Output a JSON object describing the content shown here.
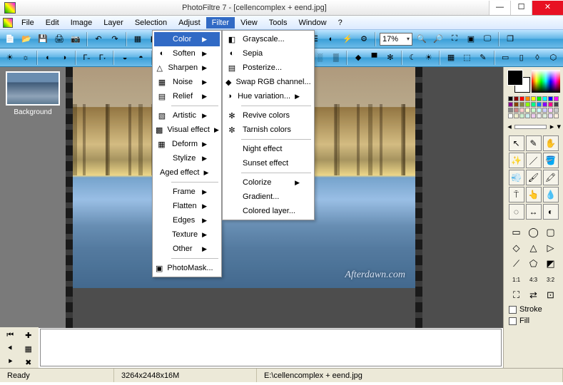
{
  "title": "PhotoFiltre 7 - [cellencomplex + eend.jpg]",
  "menubar": [
    "File",
    "Edit",
    "Image",
    "Layer",
    "Selection",
    "Adjust",
    "Filter",
    "View",
    "Tools",
    "Window",
    "?"
  ],
  "active_menu": "Filter",
  "zoom": "17%",
  "layer": {
    "label": "Background"
  },
  "watermark": "Afterdawn.com",
  "status": {
    "ready": "Ready",
    "dims": "3264x2448x16M",
    "path": "E:\\cellencomplex + eend.jpg"
  },
  "right": {
    "stroke": "Stroke",
    "fill": "Fill"
  },
  "filter_menu": [
    {
      "label": "Color",
      "sub": true,
      "hl": true
    },
    {
      "label": "Soften",
      "sub": true,
      "icon": "◐"
    },
    {
      "label": "Sharpen",
      "sub": true,
      "icon": "△"
    },
    {
      "label": "Noise",
      "sub": true,
      "icon": "▦"
    },
    {
      "label": "Relief",
      "sub": true,
      "icon": "▤"
    },
    {
      "sep": true
    },
    {
      "label": "Artistic",
      "sub": true,
      "icon": "▧"
    },
    {
      "label": "Visual effect",
      "sub": true,
      "icon": "▩"
    },
    {
      "label": "Deform",
      "sub": true,
      "icon": "▦"
    },
    {
      "label": "Stylize",
      "sub": true
    },
    {
      "label": "Aged effect",
      "sub": true
    },
    {
      "sep": true
    },
    {
      "label": "Frame",
      "sub": true
    },
    {
      "label": "Flatten",
      "sub": true
    },
    {
      "label": "Edges",
      "sub": true
    },
    {
      "label": "Texture",
      "sub": true
    },
    {
      "label": "Other",
      "sub": true
    },
    {
      "sep": true
    },
    {
      "label": "PhotoMask...",
      "icon": "▣"
    }
  ],
  "color_menu": [
    {
      "label": "Grayscale...",
      "icon": "◧"
    },
    {
      "label": "Sepia",
      "icon": "◐"
    },
    {
      "label": "Posterize...",
      "icon": "▤"
    },
    {
      "label": "Swap RGB channel...",
      "icon": "◆"
    },
    {
      "label": "Hue variation...",
      "icon": "◑",
      "sub": true
    },
    {
      "sep": true
    },
    {
      "label": "Revive colors",
      "icon": "✻"
    },
    {
      "label": "Tarnish colors",
      "icon": "✼"
    },
    {
      "sep": true
    },
    {
      "label": "Night effect"
    },
    {
      "label": "Sunset effect"
    },
    {
      "sep": true
    },
    {
      "label": "Colorize",
      "sub": true
    },
    {
      "label": "Gradient..."
    },
    {
      "label": "Colored layer..."
    }
  ],
  "swatches": [
    "#000",
    "#800",
    "#f00",
    "#f80",
    "#ff0",
    "#0f0",
    "#0ff",
    "#00f",
    "#f0f",
    "#808",
    "#840",
    "#884",
    "#8f0",
    "#0f8",
    "#08f",
    "#80f",
    "#f08",
    "#444",
    "#888",
    "#c88",
    "#fcc",
    "#ffc",
    "#cfc",
    "#cff",
    "#ccf",
    "#fcf",
    "#ccc",
    "#fff",
    "#eec",
    "#cec",
    "#cee",
    "#ece",
    "#eee",
    "#ded",
    "#edf",
    "#fed"
  ]
}
